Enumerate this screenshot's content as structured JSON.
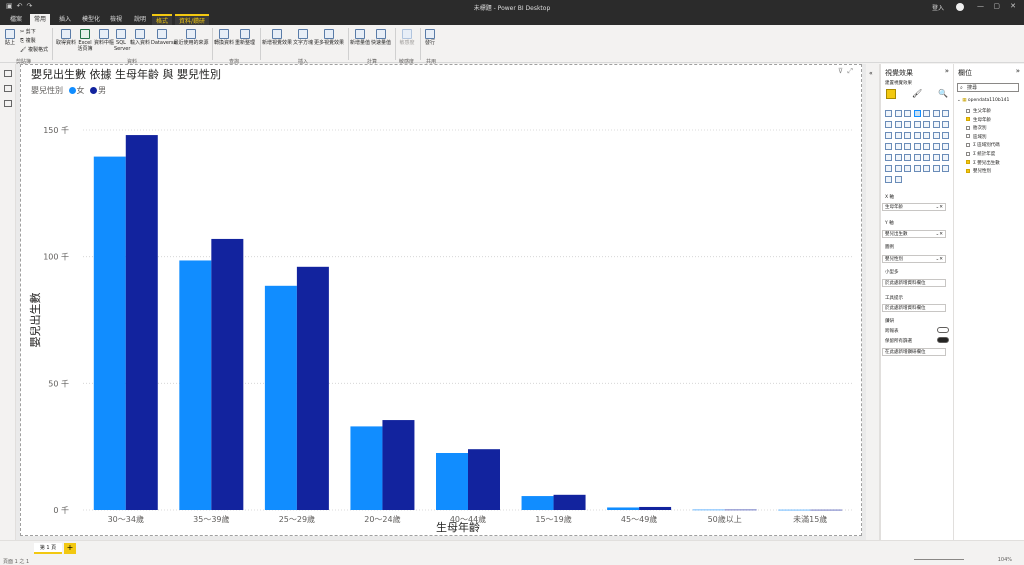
{
  "window": {
    "title": "未標題 - Power BI Desktop",
    "login": "登入"
  },
  "tabs": [
    "檔案",
    "常用",
    "插入",
    "模型化",
    "檢視",
    "說明",
    "格式",
    "資料/鑽研"
  ],
  "ribbon": {
    "clipboard": {
      "paste": "貼上",
      "cut": "剪下",
      "copy": "複製",
      "format_painter": "複製格式",
      "group": "剪貼簿"
    },
    "data": {
      "get_data": "取得資料",
      "excel": "Excel",
      "excel2": "活頁簿",
      "dataset": "資料中樞",
      "sql": "SQL",
      "sql2": "Server",
      "enter": "輸入資料",
      "dataverse": "Dataverse",
      "recent": "最近使用的來源",
      "group": "資料"
    },
    "query": {
      "transform": "轉換資料",
      "refresh": "重新整理",
      "group": "查詢"
    },
    "insert": {
      "new_visual": "新增視覺效果",
      "textbox": "文字方塊",
      "more": "更多視覺效果",
      "group": "插入"
    },
    "calc": {
      "measure": "新增量值",
      "quick": "快速量值",
      "group": "計算"
    },
    "sensitivity": {
      "label": "敏感度",
      "group": "敏感度"
    },
    "share": {
      "publish": "發行",
      "group": "共用"
    }
  },
  "chart": {
    "title": "嬰兒出生數 依據 生母年齡 與 嬰兒性別",
    "legend_title": "嬰兒性別"
  },
  "chart_data": {
    "type": "bar",
    "title": "嬰兒出生數 依據 生母年齡 與 嬰兒性別",
    "xlabel": "生母年齡",
    "ylabel": "嬰兒出生數",
    "categories": [
      "30～34歲",
      "35～39歲",
      "25～29歲",
      "20～24歲",
      "40～44歲",
      "15～19歲",
      "45～49歲",
      "50歲以上",
      "未滿15歲"
    ],
    "series": [
      {
        "name": "女",
        "color": "#118DFF",
        "values": [
          139500,
          98500,
          88500,
          33000,
          22500,
          5500,
          1000,
          150,
          100
        ]
      },
      {
        "name": "男",
        "color": "#12239E",
        "values": [
          148000,
          107000,
          96000,
          35500,
          24000,
          6000,
          1200,
          150,
          100
        ]
      }
    ],
    "ylim": [
      0,
      150000
    ],
    "yticks": [
      "0 千",
      "50 千",
      "100 千",
      "150 千"
    ],
    "grid": true,
    "legend": "top-left"
  },
  "viz_pane": {
    "title": "視覺效果",
    "subtitle": "建置視覺效果",
    "x_axis": "X 軸",
    "x_field": "生母年齡",
    "y_axis": "Y 軸",
    "y_field": "嬰兒出生數",
    "legend": "圖例",
    "legend_field": "嬰兒性別",
    "small_multiples": "小型多",
    "small_placeholder": "於此處新增資料欄位",
    "tooltips": "工具提示",
    "tooltips_placeholder": "於此處新增資料欄位",
    "drill": "鑽研",
    "cross_report": "跨報表",
    "keep_filters": "保留所有篩選",
    "drill_placeholder": "在此處新增鑽研欄位"
  },
  "fields_pane": {
    "title": "欄位",
    "search_placeholder": "搜尋",
    "table": "opendata110b141",
    "fields": [
      {
        "name": "生父年齡",
        "checked": false
      },
      {
        "name": "生母年齡",
        "checked": true
      },
      {
        "name": "胎次別",
        "checked": false
      },
      {
        "name": "區域別",
        "checked": false
      },
      {
        "name": "區域別代碼",
        "checked": false,
        "sigma": true
      },
      {
        "name": "統計年度",
        "checked": false,
        "sigma": true
      },
      {
        "name": "嬰兒出生數",
        "checked": true,
        "sigma": true
      },
      {
        "name": "嬰兒性別",
        "checked": true
      }
    ]
  },
  "status": {
    "page_tab": "第 1 頁",
    "page_info": "頁面 1 之 1",
    "zoom": "104%"
  }
}
